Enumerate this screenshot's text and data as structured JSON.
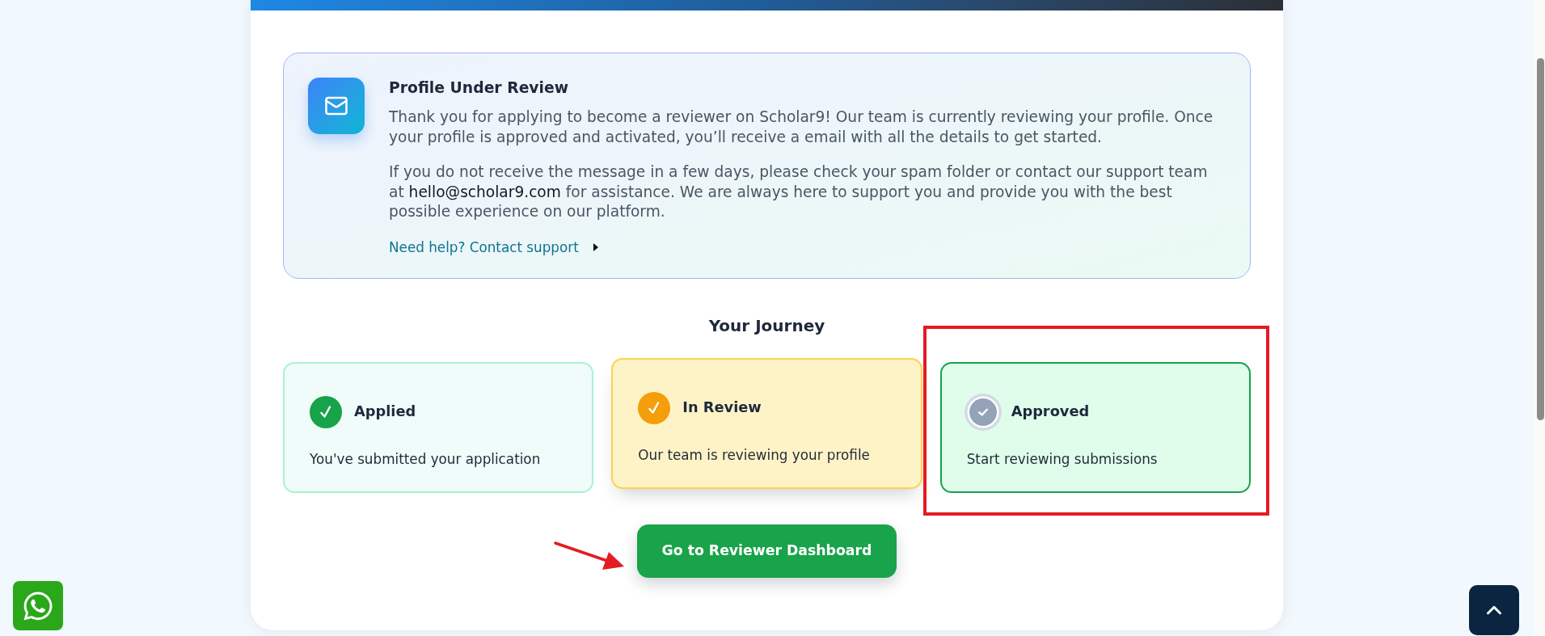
{
  "notice": {
    "title": "Profile Under Review",
    "intro": "Thank you for applying to become a reviewer on Scholar9! Our team is currently reviewing your profile. Once your profile is approved and activated, you’ll receive a email with all the details to get started.",
    "contact_note": {
      "before": "If you do not receive the message in a few days, please check your spam folder or contact our support team at",
      "email": "hello@scholar9.com",
      "after": "for assistance. We are always here to support you and provide you with the best possible experience on our platform."
    },
    "help_link": "Need help? Contact support"
  },
  "journey": {
    "title": "Your Journey",
    "steps": [
      {
        "title": "Applied",
        "description": "You've submitted your application",
        "kind": "done"
      },
      {
        "title": "In Review",
        "description": "Our team is reviewing your profile",
        "kind": "current"
      },
      {
        "title": "Approved",
        "description": "Start reviewing submissions",
        "kind": "upcoming"
      }
    ]
  },
  "dashboard_button": {
    "label": "Go to Reviewer Dashboard"
  },
  "annotations": {
    "frame": true,
    "arrow": true
  }
}
